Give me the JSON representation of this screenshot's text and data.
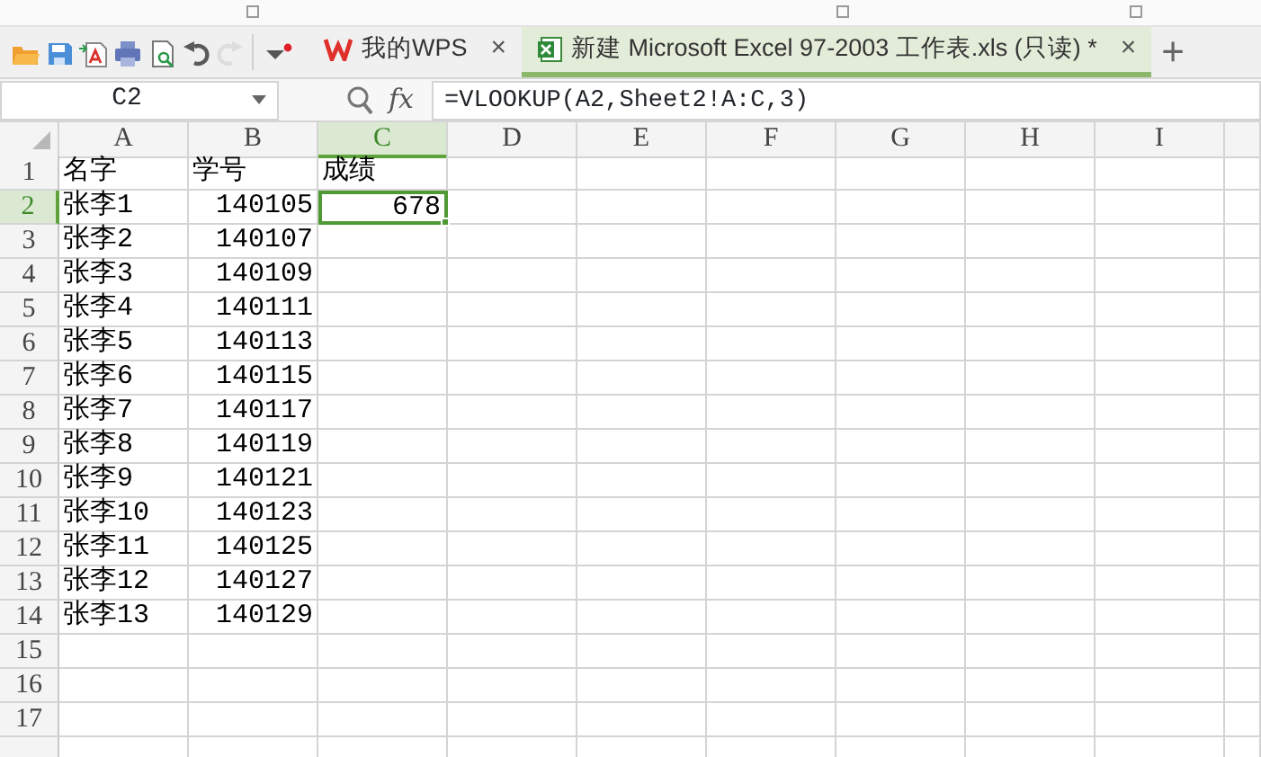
{
  "toolbar": {
    "buttons": [
      {
        "kind": "open",
        "disabled": false
      },
      {
        "kind": "save",
        "disabled": false
      },
      {
        "kind": "pdf",
        "disabled": false
      },
      {
        "kind": "print",
        "disabled": false
      },
      {
        "kind": "preview",
        "disabled": false
      },
      {
        "kind": "undo",
        "disabled": false
      },
      {
        "kind": "redo",
        "disabled": true
      }
    ]
  },
  "tabs": [
    {
      "kind": "home",
      "label": "我的WPS",
      "selected": false,
      "close": "×"
    },
    {
      "kind": "sheet",
      "label": "新建 Microsoft Excel 97-2003 工作表.xls (只读) *",
      "selected": true,
      "close": "×"
    }
  ],
  "new_tab": "+",
  "formula_bar": {
    "name_box": "C2",
    "fx": "fx",
    "formula": "=VLOOKUP(A2,Sheet2!A:C,3)"
  },
  "columns": [
    {
      "label": "A",
      "selected": false
    },
    {
      "label": "B",
      "selected": false
    },
    {
      "label": "C",
      "selected": true
    },
    {
      "label": "D",
      "selected": false
    },
    {
      "label": "E",
      "selected": false
    },
    {
      "label": "F",
      "selected": false
    },
    {
      "label": "G",
      "selected": false
    },
    {
      "label": "H",
      "selected": false
    },
    {
      "label": "I",
      "selected": false
    }
  ],
  "rows": [
    {
      "number": "1",
      "selected": false,
      "cells": [
        {
          "text": "名字",
          "kind": "text",
          "selected": false
        },
        {
          "text": "学号",
          "kind": "text",
          "selected": false
        },
        {
          "text": "成绩",
          "kind": "text",
          "selected": false
        }
      ]
    },
    {
      "number": "2",
      "selected": true,
      "cells": [
        {
          "text": "张李1",
          "kind": "text",
          "selected": false
        },
        {
          "text": "140105",
          "kind": "number",
          "selected": false
        },
        {
          "text": "678",
          "kind": "number",
          "selected": true
        }
      ]
    },
    {
      "number": "3",
      "selected": false,
      "cells": [
        {
          "text": "张李2",
          "kind": "text",
          "selected": false
        },
        {
          "text": "140107",
          "kind": "number",
          "selected": false
        }
      ]
    },
    {
      "number": "4",
      "selected": false,
      "cells": [
        {
          "text": "张李3",
          "kind": "text",
          "selected": false
        },
        {
          "text": "140109",
          "kind": "number",
          "selected": false
        }
      ]
    },
    {
      "number": "5",
      "selected": false,
      "cells": [
        {
          "text": "张李4",
          "kind": "text",
          "selected": false
        },
        {
          "text": "140111",
          "kind": "number",
          "selected": false
        }
      ]
    },
    {
      "number": "6",
      "selected": false,
      "cells": [
        {
          "text": "张李5",
          "kind": "text",
          "selected": false
        },
        {
          "text": "140113",
          "kind": "number",
          "selected": false
        }
      ]
    },
    {
      "number": "7",
      "selected": false,
      "cells": [
        {
          "text": "张李6",
          "kind": "text",
          "selected": false
        },
        {
          "text": "140115",
          "kind": "number",
          "selected": false
        }
      ]
    },
    {
      "number": "8",
      "selected": false,
      "cells": [
        {
          "text": "张李7",
          "kind": "text",
          "selected": false
        },
        {
          "text": "140117",
          "kind": "number",
          "selected": false
        }
      ]
    },
    {
      "number": "9",
      "selected": false,
      "cells": [
        {
          "text": "张李8",
          "kind": "text",
          "selected": false
        },
        {
          "text": "140119",
          "kind": "number",
          "selected": false
        }
      ]
    },
    {
      "number": "10",
      "selected": false,
      "cells": [
        {
          "text": "张李9",
          "kind": "text",
          "selected": false
        },
        {
          "text": "140121",
          "kind": "number",
          "selected": false
        }
      ]
    },
    {
      "number": "11",
      "selected": false,
      "cells": [
        {
          "text": "张李10",
          "kind": "text",
          "selected": false
        },
        {
          "text": "140123",
          "kind": "number",
          "selected": false
        }
      ]
    },
    {
      "number": "12",
      "selected": false,
      "cells": [
        {
          "text": "张李11",
          "kind": "text",
          "selected": false
        },
        {
          "text": "140125",
          "kind": "number",
          "selected": false
        }
      ]
    },
    {
      "number": "13",
      "selected": false,
      "cells": [
        {
          "text": "张李12",
          "kind": "text",
          "selected": false
        },
        {
          "text": "140127",
          "kind": "number",
          "selected": false
        }
      ]
    },
    {
      "number": "14",
      "selected": false,
      "cells": [
        {
          "text": "张李13",
          "kind": "text",
          "selected": false
        },
        {
          "text": "140129",
          "kind": "number",
          "selected": false
        }
      ]
    },
    {
      "number": "15",
      "selected": false,
      "cells": []
    },
    {
      "number": "16",
      "selected": false,
      "cells": []
    },
    {
      "number": "17",
      "selected": false,
      "cells": []
    }
  ]
}
